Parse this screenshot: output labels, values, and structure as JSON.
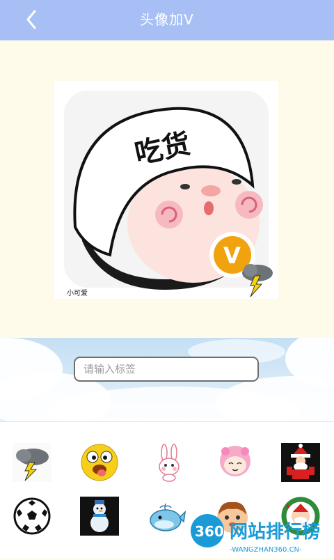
{
  "header": {
    "title": "头像加V",
    "back_icon": "chevron-left-icon"
  },
  "avatar": {
    "helmet_text": "吃货",
    "badge_letter": "V",
    "caption": "小可爱",
    "badge_color": "#f0a30f"
  },
  "tag_input": {
    "placeholder": "请输入标签",
    "value": ""
  },
  "stickers": [
    "thunder-cloud-icon",
    "goofy-face-icon",
    "bunny-icon",
    "pink-hair-girl-icon",
    "santa-icon",
    "soccer-ball-icon",
    "snowman-icon",
    "whale-icon",
    "boy-face-icon",
    "santa-wreath-icon"
  ],
  "watermark": {
    "brand": "360",
    "name": "网站排行榜",
    "url": "-WANGZHAN360.CN-"
  },
  "colors": {
    "titlebar": "#a7bff4",
    "background": "#fefbeb"
  }
}
